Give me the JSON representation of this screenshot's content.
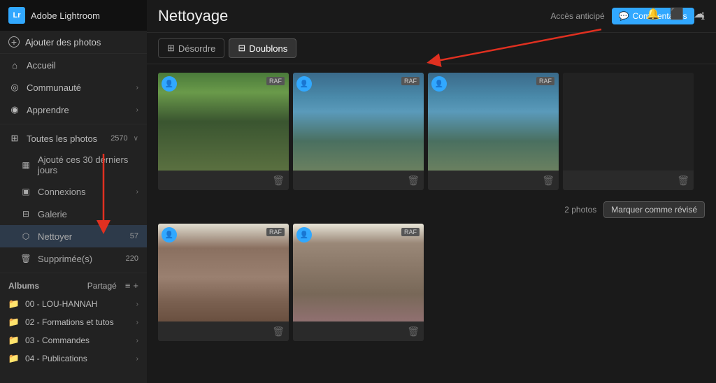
{
  "app": {
    "logo": "Lr",
    "title": "Adobe Lightroom"
  },
  "sidebar": {
    "add_photos_label": "Ajouter des photos",
    "nav_items": [
      {
        "id": "accueil",
        "label": "Accueil",
        "icon": "home"
      },
      {
        "id": "communaute",
        "label": "Communauté",
        "icon": "community",
        "has_chevron": true
      },
      {
        "id": "apprendre",
        "label": "Apprendre",
        "icon": "learn",
        "has_chevron": true
      }
    ],
    "toutes_photos": {
      "label": "Toutes les photos",
      "count": "2570",
      "icon": "grid"
    },
    "sub_items": [
      {
        "id": "ajoute",
        "label": "Ajouté ces 30 derniers jours",
        "icon": "calendar"
      },
      {
        "id": "connexions",
        "label": "Connexions",
        "icon": "connections",
        "has_chevron": true
      },
      {
        "id": "galerie",
        "label": "Galerie",
        "icon": "gallery"
      },
      {
        "id": "nettoyer",
        "label": "Nettoyer",
        "icon": "clean",
        "count": "57",
        "active": true
      },
      {
        "id": "supprimees",
        "label": "Supprimée(s)",
        "icon": "trash",
        "count": "220"
      }
    ],
    "albums_section": {
      "label": "Albums",
      "shared_label": "Partagé"
    },
    "albums": [
      {
        "id": "lou-hannah",
        "label": "00 - LOU-HANNAH",
        "has_chevron": true
      },
      {
        "id": "formations",
        "label": "02 - Formations et tutos",
        "has_chevron": true
      },
      {
        "id": "commandes",
        "label": "03 - Commandes",
        "has_chevron": true
      },
      {
        "id": "publications",
        "label": "04 - Publications",
        "has_chevron": true
      }
    ]
  },
  "main": {
    "title": "Nettoyage",
    "toolbar": {
      "early_access": "Accès anticipé",
      "commentaires": "Commentaires",
      "info_icon": "ℹ"
    },
    "tabs": [
      {
        "id": "desordre",
        "label": "Désordre",
        "active": false,
        "icon": "desordre"
      },
      {
        "id": "doublons",
        "label": "Doublons",
        "active": true,
        "icon": "doublons"
      }
    ],
    "groups": [
      {
        "id": "group1",
        "photos": [
          {
            "id": "p1",
            "type": "landscape",
            "has_raf": true,
            "selected": true
          },
          {
            "id": "p2",
            "type": "landscape",
            "has_raf": true,
            "selected": true
          },
          {
            "id": "p3",
            "type": "landscape",
            "has_raf": true,
            "selected": true
          },
          {
            "id": "p4",
            "type": "landscape_empty",
            "has_raf": false,
            "selected": false
          }
        ]
      },
      {
        "id": "group2",
        "count_label": "2 photos",
        "mark_reviewed_label": "Marquer comme révisé",
        "photos": [
          {
            "id": "p5",
            "type": "cliff1",
            "has_raf": true,
            "selected": true
          },
          {
            "id": "p6",
            "type": "cliff2",
            "has_raf": true,
            "selected": true
          }
        ]
      }
    ]
  }
}
